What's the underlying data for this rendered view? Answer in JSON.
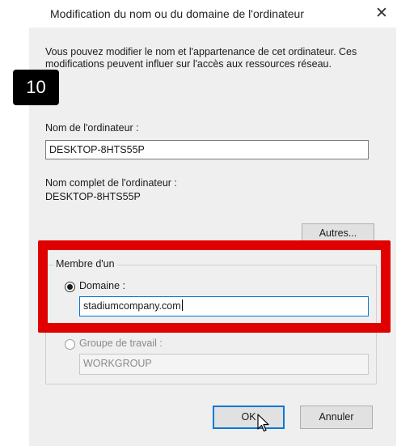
{
  "window": {
    "title": "Modification du nom ou du domaine de l'ordinateur",
    "close_icon": "close-icon"
  },
  "description": "Vous pouvez modifier le nom et l'appartenance de cet ordinateur. Ces modifications peuvent influer sur l'accès aux ressources réseau.",
  "step_badge": "10",
  "computer_name": {
    "label": "Nom de l'ordinateur :",
    "value": "DESKTOP-8HTS55P"
  },
  "full_name": {
    "label": "Nom complet de l'ordinateur :",
    "value": "DESKTOP-8HTS55P"
  },
  "more_button": "Autres...",
  "member_of": {
    "legend": "Membre d'un",
    "domain": {
      "label": "Domaine :",
      "value": "stadiumcompany.com",
      "selected": true
    },
    "workgroup": {
      "label": "Groupe de travail :",
      "value": "WORKGROUP",
      "selected": false
    }
  },
  "buttons": {
    "ok": "OK",
    "cancel": "Annuler"
  },
  "colors": {
    "highlight": "#e00000",
    "dialog_bg": "#efefef",
    "focus_blue": "#0078d7"
  }
}
